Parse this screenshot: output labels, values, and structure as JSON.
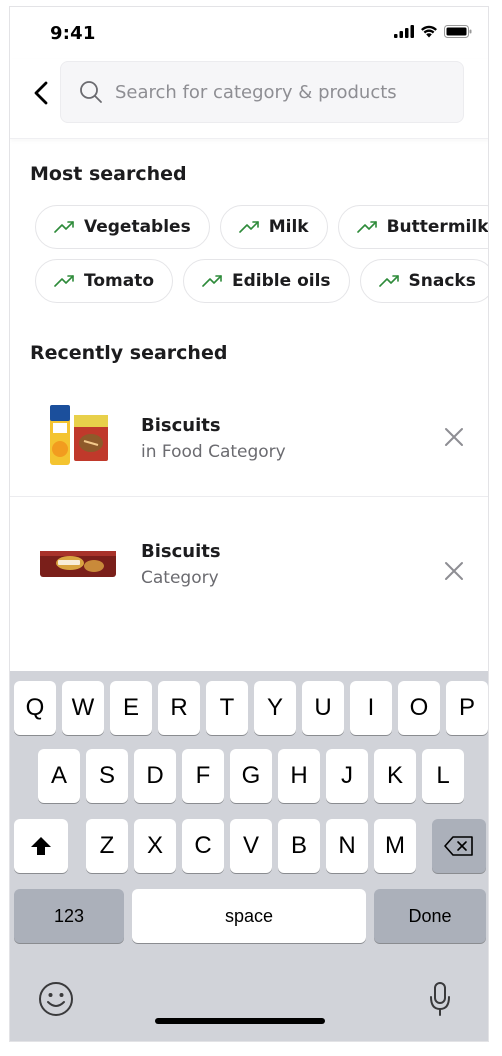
{
  "status_bar": {
    "time": "9:41",
    "icons": [
      "signal-icon",
      "wifi-icon",
      "battery-icon"
    ]
  },
  "search": {
    "placeholder": "Search for category & products",
    "value": ""
  },
  "most_searched": {
    "title": "Most searched",
    "row1": [
      "Vegetables",
      "Milk",
      "Buttermilk"
    ],
    "row2": [
      "Tomato",
      "Edible oils",
      "Snacks"
    ]
  },
  "recently_searched": {
    "title": "Recently searched",
    "items": [
      {
        "title": "Biscuits",
        "subtitle": "in Food Category",
        "thumb": "food-products-image"
      },
      {
        "title": "Biscuits",
        "subtitle": "Category",
        "thumb": "biscuit-pack-image"
      }
    ]
  },
  "keyboard": {
    "row1": [
      "Q",
      "W",
      "E",
      "R",
      "T",
      "Y",
      "U",
      "I",
      "O",
      "P"
    ],
    "row2": [
      "A",
      "S",
      "D",
      "F",
      "G",
      "H",
      "J",
      "K",
      "L"
    ],
    "row3": [
      "Z",
      "X",
      "C",
      "V",
      "B",
      "N",
      "M"
    ],
    "numbers_key": "123",
    "space_key": "space",
    "done_key": "Done"
  },
  "colors": {
    "accent_green": "#2e8b3a",
    "keyboard_bg": "#d1d3d9",
    "dark_key": "#abb0ba"
  }
}
